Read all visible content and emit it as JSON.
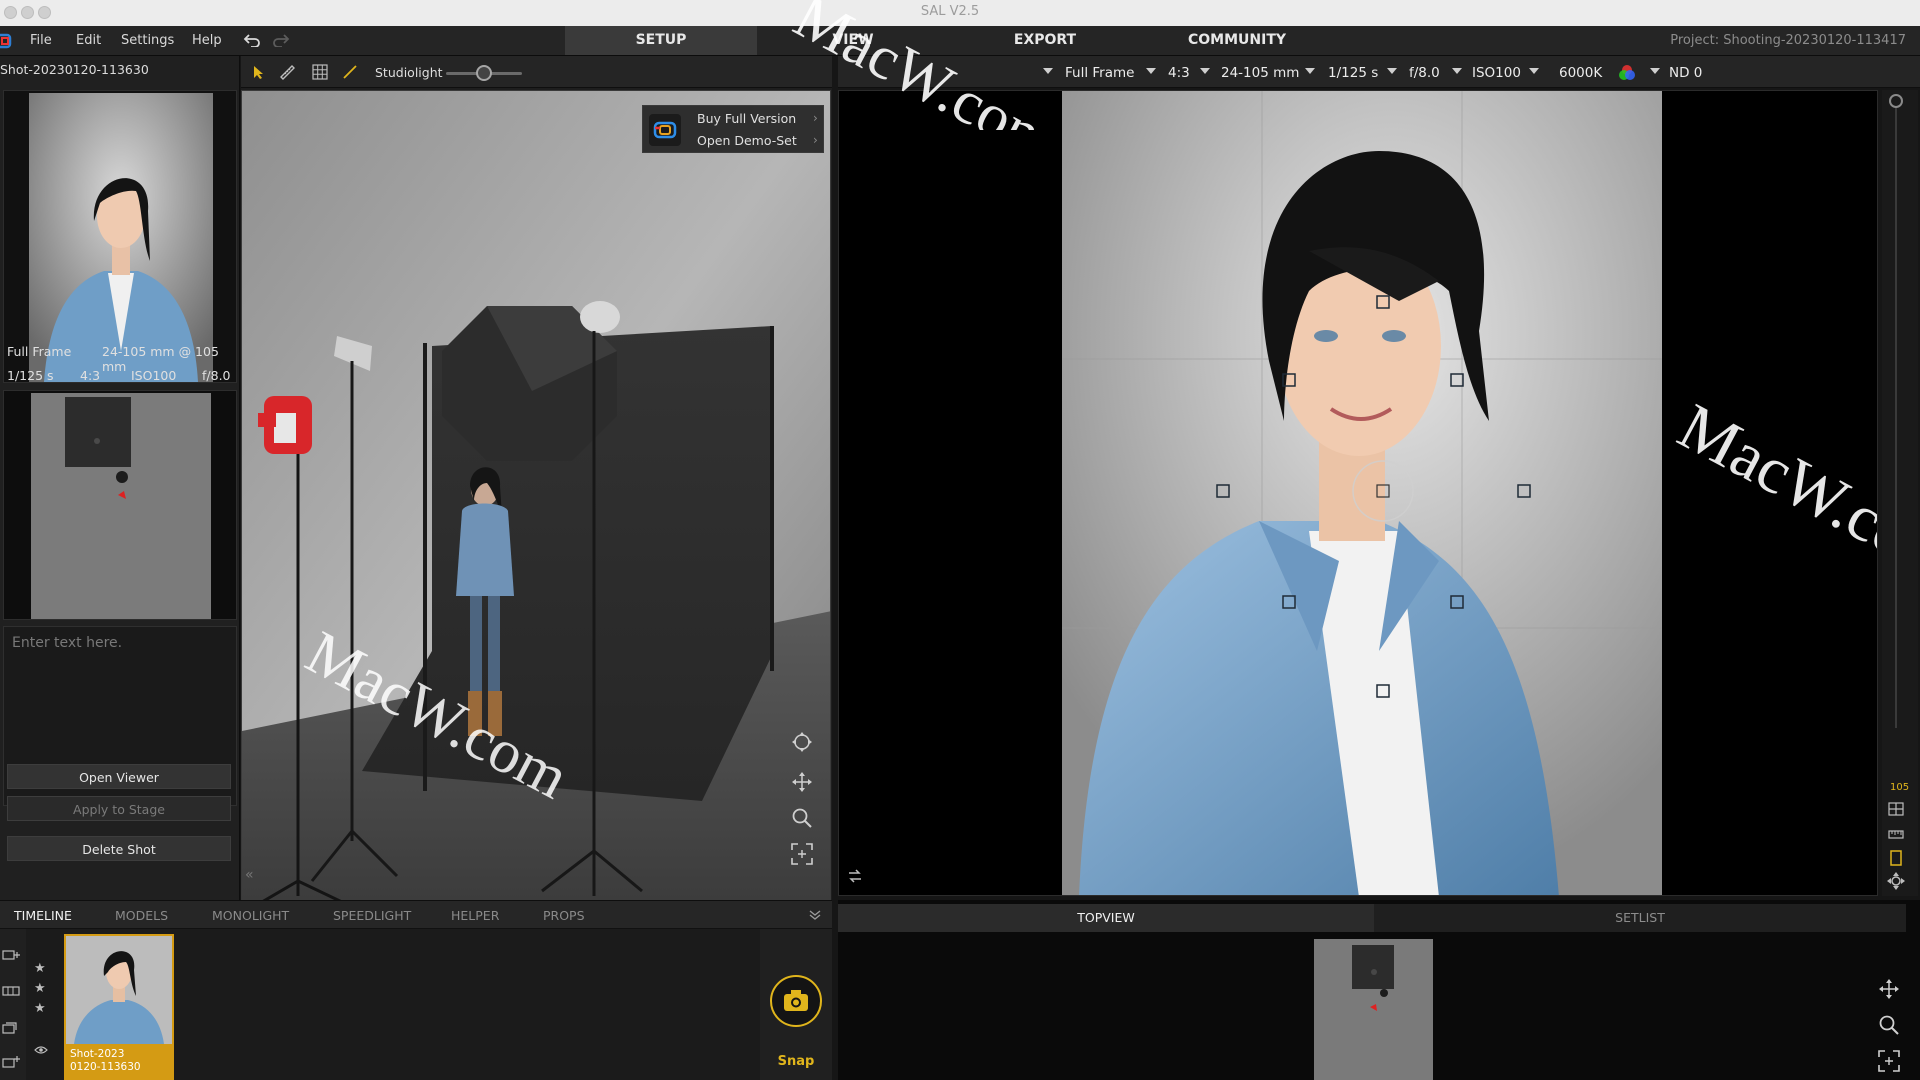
{
  "window": {
    "title": "SAL V2.5"
  },
  "menu": {
    "file": "File",
    "edit": "Edit",
    "settings": "Settings",
    "help": "Help",
    "tabs": [
      "SETUP",
      "VIEW",
      "EXPORT",
      "COMMUNITY"
    ],
    "project": "Project: Shooting-20230120-113417"
  },
  "shot": {
    "name": "Shot-20230120-113630",
    "sensor": "Full Frame",
    "lens": "24-105 mm @ 105 mm",
    "shutter": "1/125 s",
    "ratio": "4:3",
    "iso": "ISO100",
    "aperture": "f/8.0",
    "notes_placeholder": "Enter text here."
  },
  "left_buttons": {
    "open_viewer": "Open Viewer",
    "apply_to_stage": "Apply to Stage",
    "delete_shot": "Delete Shot"
  },
  "toolbar": {
    "studiolight_label": "Studiolight",
    "studiolight_value": 0.5
  },
  "demo_menu": {
    "buy": "Buy Full Version",
    "open_demo": "Open Demo-Set"
  },
  "camera_strip": {
    "sensor": "Full Frame",
    "ratio": "4:3",
    "lens": "24-105 mm",
    "shutter": "1/125 s",
    "aperture": "f/8.0",
    "iso": "ISO100",
    "wb": "6000K",
    "nd": "ND 0"
  },
  "camera_rail": {
    "focal_value": "105"
  },
  "bottom_tabs": [
    "TIMELINE",
    "MODELS",
    "MONOLIGHT",
    "SPEEDLIGHT",
    "HELPER",
    "PROPS"
  ],
  "timeline": {
    "item_caption_line1": "Shot-2023",
    "item_caption_line2": "0120-113630",
    "snap_label": "Snap"
  },
  "right_tabs": [
    "TOPVIEW",
    "SETLIST"
  ],
  "watermark": "MacW.com",
  "colors": {
    "accent": "#d49b14",
    "snap": "#e0b51c",
    "camera_red": "#d8262a",
    "panel": "#202020"
  }
}
